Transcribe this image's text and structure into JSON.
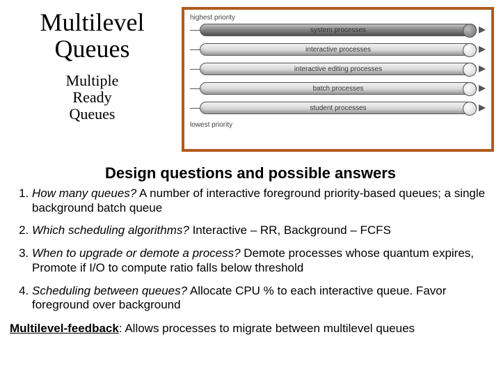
{
  "title_line1": "Multilevel",
  "title_line2": "Queues",
  "subtitle_line1": "Multiple",
  "subtitle_line2": "Ready",
  "subtitle_line3": "Queues",
  "diagram": {
    "top_label": "highest priority",
    "bottom_label": "lowest priority",
    "queues": [
      {
        "label": "system processes",
        "shade": "dark"
      },
      {
        "label": "interactive processes",
        "shade": "light"
      },
      {
        "label": "interactive editing processes",
        "shade": "light"
      },
      {
        "label": "batch processes",
        "shade": "light"
      },
      {
        "label": "student processes",
        "shade": "light"
      }
    ]
  },
  "section_heading": "Design questions and possible answers",
  "qa": [
    {
      "q": "How many queues?",
      "a": " A number of interactive foreground priority-based queues; a single background batch queue"
    },
    {
      "q": "Which scheduling algorithms?",
      "a": " Interactive – RR, Background – FCFS"
    },
    {
      "q": "When to upgrade or demote a process?",
      "a": " Demote processes whose quantum expires, Promote if I/O to compute ratio falls below threshold"
    },
    {
      "q": "Scheduling between queues?",
      "a": " Allocate CPU % to each interactive queue. Favor foreground over background"
    }
  ],
  "footer": {
    "lead": "Multilevel-feedback",
    "rest": ": Allows processes to migrate between multilevel queues"
  }
}
